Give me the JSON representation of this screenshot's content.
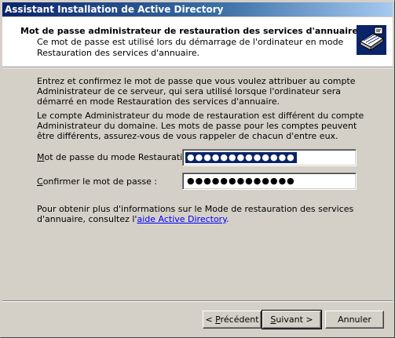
{
  "window": {
    "title": "Assistant Installation de Active Directory"
  },
  "header": {
    "title": "Mot de passe administrateur de restauration des services d'annuaire",
    "subtitle": "Ce mot de passe est utilisé lors du démarrage de l'ordinateur en mode Restauration des services d'annuaire.",
    "icon": "directory-book-icon"
  },
  "body": {
    "paragraph1": "Entrez et confirmez le mot de passe que vous voulez attribuer au compte Administrateur de ce serveur, qui sera utilisé lorsque l'ordinateur sera démarré en mode Restauration des services d'annuaire.",
    "paragraph2": "Le compte Administrateur du mode de restauration est différent du compte Administrateur du domaine. Les mots de passe pour les comptes peuvent être différents, assurez-vous de vous rappeler de chacun d'entre eux.",
    "password_label_prefix": "M",
    "password_label_rest": "ot de passe du mode Restauration :",
    "password_value": "●●●●●●●●●●●●●",
    "confirm_label_prefix": "C",
    "confirm_label_rest": "onfirmer le mot de passe :",
    "confirm_value": "●●●●●●●●●●●●●",
    "info_text": "Pour obtenir plus d'informations sur le Mode de restauration des services d'annuaire, consultez l'",
    "info_link": "aide Active Directory",
    "info_end": "."
  },
  "buttons": {
    "prev_prefix": "< ",
    "prev_accel": "P",
    "prev_rest": "récédent",
    "next_accel": "S",
    "next_rest": "uivant >",
    "cancel": "Annuler"
  },
  "colors": {
    "titlebar_start": "#0a246a",
    "titlebar_end": "#a6caf0",
    "selection": "#0a246a",
    "link": "#0000ff",
    "face": "#d4d0c8"
  }
}
